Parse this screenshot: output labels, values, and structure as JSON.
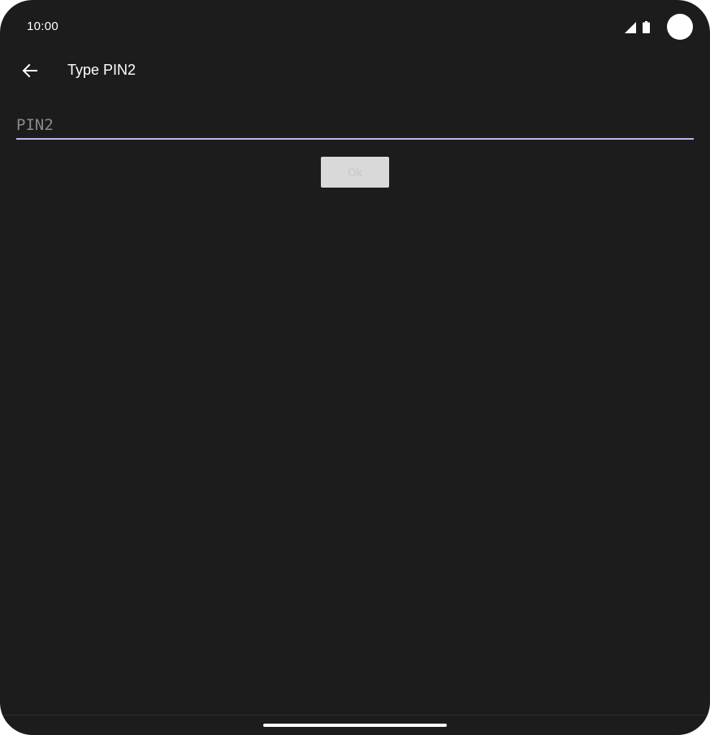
{
  "status_bar": {
    "time": "10:00",
    "icons": [
      "signal-icon",
      "battery-icon"
    ]
  },
  "app_bar": {
    "back_icon": "arrow-back-icon",
    "title": "Type PIN2"
  },
  "pin_field": {
    "placeholder": "PIN2",
    "value": ""
  },
  "ok_button": {
    "label": "Ok",
    "enabled": false
  },
  "colors": {
    "background": "#1c1c1c",
    "input_underline": "#b9b8f2",
    "button_disabled_bg": "#d9d9d9"
  }
}
